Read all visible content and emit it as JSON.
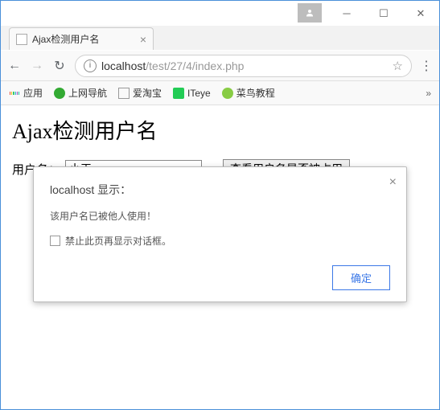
{
  "window": {
    "tab_title": "Ajax检测用户名",
    "url_host": "localhost",
    "url_path": "/test/27/4/index.php"
  },
  "bookmarks": {
    "apps": "应用",
    "items": [
      "上网导航",
      "爱淘宝",
      "ITeye",
      "菜鸟教程"
    ]
  },
  "page": {
    "heading": "Ajax检测用户名",
    "label_username": "用户名：",
    "username_value": "小王",
    "check_button": "查看用户名是否被占用"
  },
  "dialog": {
    "title": "localhost 显示：",
    "message": "该用户名已被他人使用！",
    "suppress_label": "禁止此页再显示对话框。",
    "ok": "确定"
  }
}
